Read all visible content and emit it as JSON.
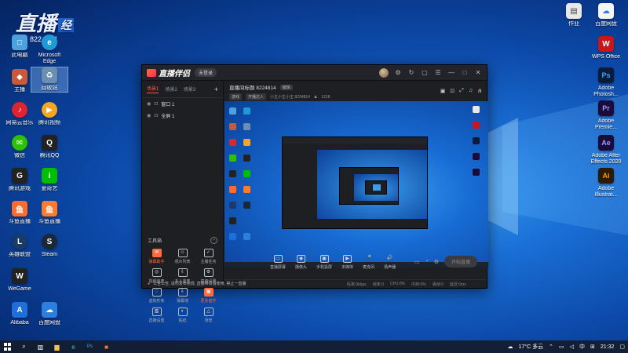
{
  "desktop": {
    "overlay_text": [
      "直播",
      "经",
      "8224814"
    ],
    "icons_left": [
      {
        "label": "此电脑",
        "color": "#4aa3df",
        "glyph": "□"
      },
      {
        "label": "Microsoft Edge",
        "color": "#1e9bd7",
        "glyph": "e"
      },
      {
        "label": "回收站",
        "color": "#6b8fb3",
        "glyph": "♻"
      },
      {
        "label": "主播",
        "color": "#c85a3a",
        "glyph": "◆"
      },
      {
        "label": "网易云音乐",
        "color": "#e0242f",
        "glyph": "♪"
      },
      {
        "label": "腾讯视频",
        "color": "#f5a623",
        "glyph": "▶"
      },
      {
        "label": "微信",
        "color": "#2dc100",
        "glyph": "✉"
      },
      {
        "label": "腾讯QQ",
        "color": "#222",
        "glyph": "Q"
      },
      {
        "label": "腾讯游戏",
        "color": "#222",
        "glyph": "G"
      },
      {
        "label": "爱奇艺",
        "color": "#00be06",
        "glyph": "i"
      },
      {
        "label": "斗鱼直播",
        "color": "#ff6a2d",
        "glyph": "鱼"
      },
      {
        "label": "斗鱼直播",
        "color": "#ff7a2d",
        "glyph": "鱼"
      },
      {
        "label": "英雄联盟",
        "color": "#1a3a6a",
        "glyph": "L"
      },
      {
        "label": "Steam",
        "color": "#1b2838",
        "glyph": "S"
      },
      {
        "label": "WeGame",
        "color": "#222",
        "glyph": "W"
      },
      {
        "label": "Alibaba",
        "color": "#1e6fd9",
        "glyph": "A"
      },
      {
        "label": "百度网盘",
        "color": "#2a7fe0",
        "glyph": "☁"
      }
    ],
    "icons_right": [
      {
        "label": "作业",
        "color": "#e8e8e8",
        "glyph": "▤"
      },
      {
        "label": "百度网盘",
        "color": "#f5f5f5",
        "glyph": "☁"
      },
      {
        "label": "WPS Office",
        "color": "#c8161d",
        "glyph": "W"
      },
      {
        "label": "Adobe Photosh...",
        "color": "#0c1b3a",
        "glyph": "Ps"
      },
      {
        "label": "Adobe Premie...",
        "color": "#1a0b3a",
        "glyph": "Pr"
      },
      {
        "label": "Adobe After Effects 2020",
        "color": "#1a0b3a",
        "glyph": "Ae"
      },
      {
        "label": "Adobe Illustrat...",
        "color": "#2a1a06",
        "glyph": "Ai"
      }
    ]
  },
  "app": {
    "logo": "直播伴侣",
    "login": "未登录",
    "title_buttons": [
      "⚙",
      "↻",
      "▢",
      "☰",
      "—",
      "□",
      "✕"
    ],
    "scene_tabs": [
      "场景1",
      "场景2",
      "场景3"
    ],
    "sources": [
      {
        "label": "窗口 1"
      },
      {
        "label": "全屏 1"
      }
    ],
    "tools_title": "工具箱",
    "tools": [
      {
        "label": "弹幕助手",
        "glyph": "✉",
        "hot": true
      },
      {
        "label": "观众列表",
        "glyph": "☺",
        "hot": false
      },
      {
        "label": "主播任务",
        "glyph": "✓",
        "hot": false
      },
      {
        "label": "视频连麦",
        "glyph": "◎",
        "hot": false
      },
      {
        "label": "多人连麦",
        "glyph": "⇩",
        "hot": false
      },
      {
        "label": "高级设置",
        "glyph": "⚙",
        "hot": false
      },
      {
        "label": "虚拟形象",
        "glyph": "♡",
        "hot": false
      },
      {
        "label": "弹幕墙",
        "glyph": "⇩",
        "hot": false
      },
      {
        "label": "更多插件",
        "glyph": "▦",
        "hot": true
      },
      {
        "label": "直播设置",
        "glyph": "▥",
        "hot": false
      },
      {
        "label": "贴纸",
        "glyph": "◐",
        "hot": false
      },
      {
        "label": "场景",
        "glyph": "△",
        "hot": false
      }
    ],
    "room": {
      "title": "直播间标题 8224814",
      "edit": "编辑",
      "category": "游戏",
      "tag": "开播达人",
      "subtitle": "小主小主小主 8224814",
      "viewers": "1216"
    },
    "controls": [
      {
        "label": "直播屏幕",
        "glyph": "▭"
      },
      {
        "label": "摄像头",
        "glyph": "◉"
      },
      {
        "label": "手机投屏",
        "glyph": "▣"
      },
      {
        "label": "多媒体",
        "glyph": "▶"
      },
      {
        "label": "麦克风",
        "glyph": "🎤"
      },
      {
        "label": "扬声器",
        "glyph": "🔊"
      }
    ],
    "start_label": "开始直播",
    "notice": "公告公告, 请勿发布违规, 直播带货请使用, 禁止一直播",
    "status_items": [
      "码率:0kbps",
      "帧率:0",
      "CPU:0%",
      "内存:0%",
      "丢帧:0",
      "延迟:0ms"
    ]
  },
  "taskbar": {
    "weather": "17°C 多云",
    "time": "21:32",
    "lang": "中"
  }
}
